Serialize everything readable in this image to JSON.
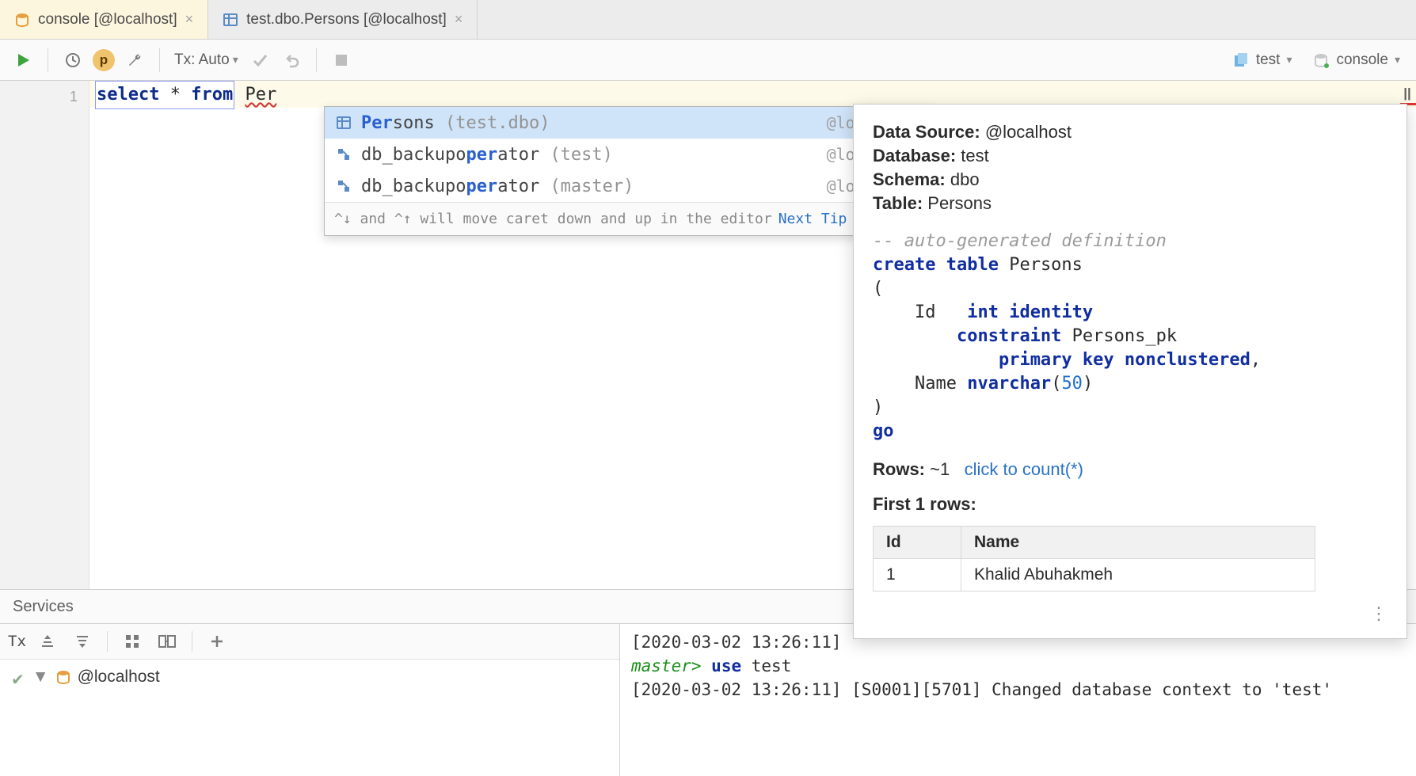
{
  "tabs": [
    {
      "label": "console [@localhost]",
      "icon": "db-console-icon",
      "active": true
    },
    {
      "label": "test.dbo.Persons [@localhost]",
      "icon": "table-icon",
      "active": false
    }
  ],
  "toolbar": {
    "run_title": "Run",
    "history_title": "History",
    "p_badge": "p",
    "wrench_title": "Settings",
    "tx_label": "Tx: Auto",
    "commit_title": "Commit",
    "rollback_title": "Rollback",
    "stop_title": "Stop",
    "datasource_name": "test",
    "console_name": "console"
  },
  "editor": {
    "line_numbers": [
      "1"
    ],
    "kw_select": "select",
    "star": "*",
    "kw_from": "from",
    "typed_fragment": "Per",
    "pause_marker": "||"
  },
  "autocomplete": {
    "items": [
      {
        "match": "Per",
        "rest": "sons",
        "qualifier": "(test.dbo)",
        "source": "@localhost",
        "icon": "table-icon",
        "selected": true
      },
      {
        "pre": "db_backupo",
        "match": "per",
        "rest": "ator",
        "qualifier": "(test)",
        "source": "@localhost",
        "icon": "role-icon",
        "selected": false
      },
      {
        "pre": "db_backupo",
        "match": "per",
        "rest": "ator",
        "qualifier": "(master)",
        "source": "@localhost",
        "icon": "role-icon",
        "selected": false
      }
    ],
    "footer_hint": "^↓ and ^↑ will move caret down and up in the editor",
    "footer_link": "Next Tip"
  },
  "doc": {
    "labels": {
      "data_source": "Data Source:",
      "database": "Database:",
      "schema": "Schema:",
      "table": "Table:",
      "rows": "Rows:",
      "first_rows": "First 1 rows:"
    },
    "data_source": "@localhost",
    "database": "test",
    "schema": "dbo",
    "table": "Persons",
    "rows_approx": "~1",
    "count_link": "click to count(*)",
    "comment": "-- auto-generated definition",
    "preview": {
      "columns": [
        "Id",
        "Name"
      ],
      "rows": [
        {
          "Id": "1",
          "Name": "Khalid Abuhakmeh"
        }
      ]
    },
    "ddl": {
      "create_kw": "create table",
      "table_name": "Persons",
      "col1_name": "Id",
      "col1_type": "int identity",
      "constraint_kw": "constraint",
      "constraint_name": "Persons_pk",
      "pk_kw": "primary key nonclustered",
      "col2_name": "Name",
      "col2_type": "nvarchar",
      "col2_size": "50",
      "go_kw": "go"
    },
    "more_title": "More"
  },
  "services": {
    "title": "Services",
    "tx_label": "Tx",
    "add_title": "Add",
    "node_label": "@localhost",
    "output": {
      "line1_ts": "[2020-03-02 13:26:11]",
      "prompt": "master>",
      "use_kw": "use",
      "db": "test",
      "line3_ts": "[2020-03-02 13:26:11]",
      "line3_rest": " [S0001][5701] Changed database context to 'test'"
    }
  }
}
